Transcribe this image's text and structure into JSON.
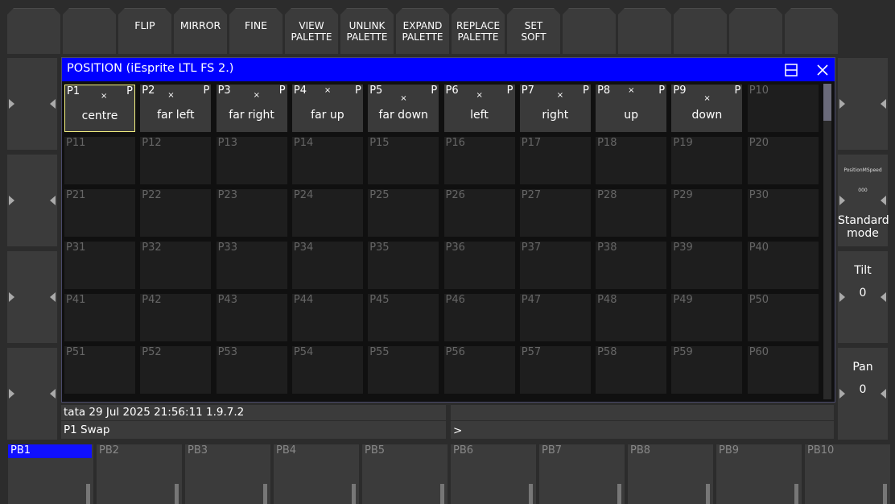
{
  "toolbar": [
    "",
    "",
    "FLIP",
    "MIRROR",
    "FINE",
    "VIEW\nPALETTE",
    "UNLINK\nPALETTE",
    "EXPAND\nPALETTE",
    "REPLACE\nPALETTE",
    "SET\nSOFT",
    "",
    "",
    "",
    "",
    ""
  ],
  "window": {
    "title": "POSITION (iEsprite LTL FS 2.)"
  },
  "palettes": [
    {
      "id": "P1",
      "name": "centre",
      "set": true
    },
    {
      "id": "P2",
      "name": "far left",
      "set": true
    },
    {
      "id": "P3",
      "name": "far right",
      "set": true
    },
    {
      "id": "P4",
      "name": "far up",
      "set": true
    },
    {
      "id": "P5",
      "name": "far down",
      "set": true
    },
    {
      "id": "P6",
      "name": "left",
      "set": true
    },
    {
      "id": "P7",
      "name": "right",
      "set": true
    },
    {
      "id": "P8",
      "name": "up",
      "set": true
    },
    {
      "id": "P9",
      "name": "down",
      "set": true
    },
    {
      "id": "P10",
      "name": "",
      "set": false
    },
    {
      "id": "P11"
    },
    {
      "id": "P12"
    },
    {
      "id": "P13"
    },
    {
      "id": "P14"
    },
    {
      "id": "P15"
    },
    {
      "id": "P16"
    },
    {
      "id": "P17"
    },
    {
      "id": "P18"
    },
    {
      "id": "P19"
    },
    {
      "id": "P20"
    },
    {
      "id": "P21"
    },
    {
      "id": "P22"
    },
    {
      "id": "P23"
    },
    {
      "id": "P24"
    },
    {
      "id": "P25"
    },
    {
      "id": "P26"
    },
    {
      "id": "P27"
    },
    {
      "id": "P28"
    },
    {
      "id": "P29"
    },
    {
      "id": "P30"
    },
    {
      "id": "P31"
    },
    {
      "id": "P32"
    },
    {
      "id": "P33"
    },
    {
      "id": "P34"
    },
    {
      "id": "P35"
    },
    {
      "id": "P36"
    },
    {
      "id": "P37"
    },
    {
      "id": "P38"
    },
    {
      "id": "P39"
    },
    {
      "id": "P40"
    },
    {
      "id": "P41"
    },
    {
      "id": "P42"
    },
    {
      "id": "P43"
    },
    {
      "id": "P44"
    },
    {
      "id": "P45"
    },
    {
      "id": "P46"
    },
    {
      "id": "P47"
    },
    {
      "id": "P48"
    },
    {
      "id": "P49"
    },
    {
      "id": "P50"
    },
    {
      "id": "P51"
    },
    {
      "id": "P52"
    },
    {
      "id": "P53"
    },
    {
      "id": "P54"
    },
    {
      "id": "P55"
    },
    {
      "id": "P56"
    },
    {
      "id": "P57"
    },
    {
      "id": "P58"
    },
    {
      "id": "P59"
    },
    {
      "id": "P60"
    }
  ],
  "palette_marks": {
    "x": "×",
    "p": "P"
  },
  "right_panel": {
    "speed_label": "PositionMSpeed",
    "speed_value": "000",
    "mode": "Standard mode",
    "tilt_label": "Tilt",
    "tilt_value": "0",
    "pan_label": "Pan",
    "pan_value": "0"
  },
  "status": {
    "info": "tata 29 Jul 2025 21:56:11 1.9.7.2",
    "command": "P1  Swap",
    "prompt": ">"
  },
  "playbacks": [
    "PB1",
    "PB2",
    "PB3",
    "PB4",
    "PB5",
    "PB6",
    "PB7",
    "PB8",
    "PB9",
    "PB10"
  ],
  "icons": {
    "restore": "restore-icon",
    "close": "close-icon"
  },
  "colors": {
    "titlebar": "#0000ff",
    "selected_border": "#f4f080",
    "active_playback": "#1010ff"
  }
}
